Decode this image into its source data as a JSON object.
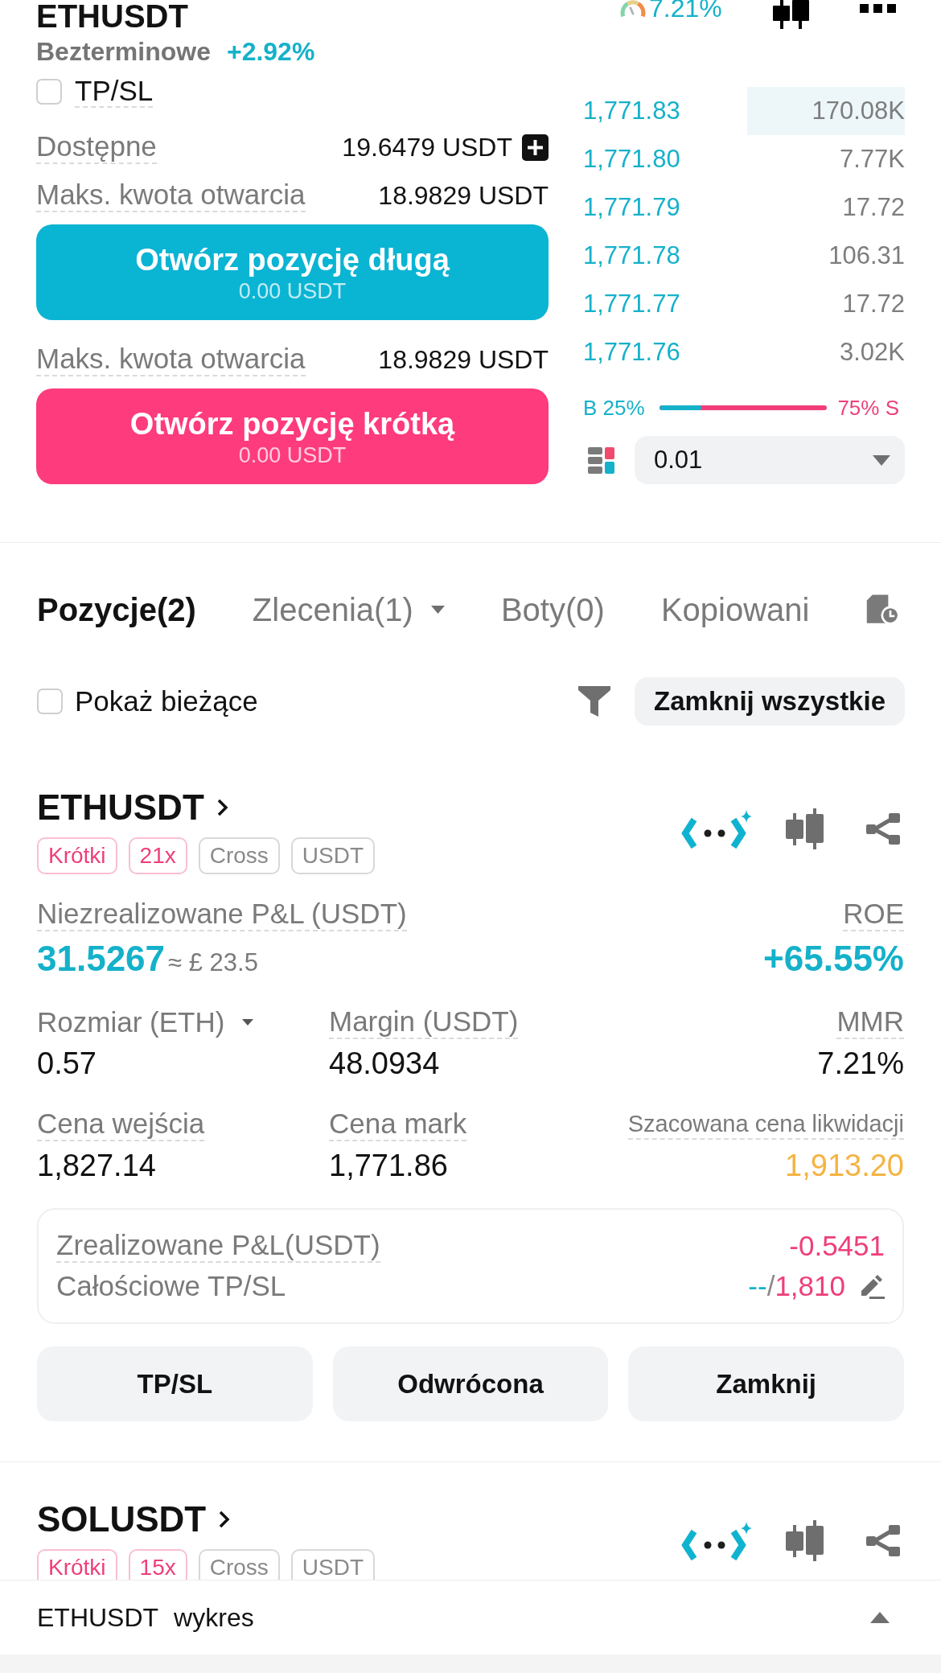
{
  "header": {
    "pair": "ETHUSDT",
    "contract_type": "Bezterminowe",
    "change": "+2.92%",
    "funding_rate": "7.21%"
  },
  "order_form": {
    "tpsl": {
      "label": "TP/SL",
      "checked": false
    },
    "available": {
      "label": "Dostępne",
      "value": "19.6479 USDT"
    },
    "sides": [
      {
        "kind": "long",
        "max_label": "Maks. kwota otwarcia",
        "max_value": "18.9829 USDT",
        "button": "Otwórz pozycję długą",
        "amount": "0.00 USDT"
      },
      {
        "kind": "short",
        "max_label": "Maks. kwota otwarcia",
        "max_value": "18.9829 USDT",
        "button": "Otwórz pozycję krótką",
        "amount": "0.00 USDT"
      }
    ]
  },
  "order_book": {
    "rows": [
      {
        "price": "1,771.83",
        "quantity": "170.08K",
        "level": 0.49
      },
      {
        "price": "1,771.80",
        "quantity": "7.77K"
      },
      {
        "price": "1,771.79",
        "quantity": "17.72"
      },
      {
        "price": "1,771.78",
        "quantity": "106.31"
      },
      {
        "price": "1,771.77",
        "quantity": "17.72"
      },
      {
        "price": "1,771.76",
        "quantity": "3.02K"
      }
    ],
    "ratio": {
      "buy": "B 25%",
      "sell": "75% S",
      "level": 0.25
    },
    "precision": "0.01"
  },
  "tabs": [
    {
      "label": "Pozycje(2)",
      "selected": true,
      "kind": "plain"
    },
    {
      "label": "Zlecenia(1)",
      "selected": false,
      "kind": "dropdown"
    },
    {
      "label": "Boty(0)",
      "selected": false,
      "kind": "plain"
    },
    {
      "label": "Kopiowani",
      "selected": false,
      "kind": "plain"
    }
  ],
  "filter": {
    "show_current": {
      "label": "Pokaż bieżące",
      "checked": false
    },
    "close_all": "Zamknij wszystkie"
  },
  "positions": [
    {
      "symbol": "ETHUSDT",
      "tags": [
        {
          "label": "Krótki",
          "color": "#ee3f7b"
        },
        {
          "label": "21x",
          "color": "#ee3f7b"
        },
        {
          "label": "Cross",
          "color": "#8a8a8a"
        },
        {
          "label": "USDT",
          "color": "#8a8a8a"
        }
      ],
      "unrealized": {
        "label": "Niezrealizowane P&L (USDT)",
        "value": "31.5267",
        "fiat": "≈ £ 23.5"
      },
      "roe": {
        "label": "ROE",
        "value": "+65.55%"
      },
      "stats": [
        {
          "label": "Rozmiar (ETH)",
          "value": "0.57",
          "kind": "dropdown"
        },
        {
          "label": "Margin (USDT)",
          "value": "48.0934",
          "kind": "tooltip"
        },
        {
          "label": "MMR",
          "value": "7.21%",
          "kind": "tooltip"
        },
        {
          "label": "Cena wejścia",
          "value": "1,827.14",
          "kind": "tooltip"
        },
        {
          "label": "Cena mark",
          "value": "1,771.86",
          "kind": "tooltip"
        },
        {
          "label": "Szacowana cena likwidacji",
          "value": "1,913.20",
          "kind": "liquidation"
        }
      ],
      "realized": {
        "label": "Zrealizowane P&L(USDT)",
        "value": "-0.5451"
      },
      "tpsl": {
        "label": "Całościowe TP/SL",
        "take_profit": "--",
        "divider": "/",
        "stop_loss": "1,810"
      },
      "actions": [
        "TP/SL",
        "Odwrócona",
        "Zamknij"
      ]
    },
    {
      "symbol": "SOLUSDT",
      "tags": [
        {
          "label": "Krótki",
          "color": "#ee3f7b"
        },
        {
          "label": "15x",
          "color": "#ee3f7b"
        },
        {
          "label": "Cross",
          "color": "#8a8a8a"
        },
        {
          "label": "USDT",
          "color": "#8a8a8a"
        }
      ]
    }
  ],
  "bottom_bar": {
    "symbol": "ETHUSDT",
    "label": "wykres",
    "expanded": false
  }
}
